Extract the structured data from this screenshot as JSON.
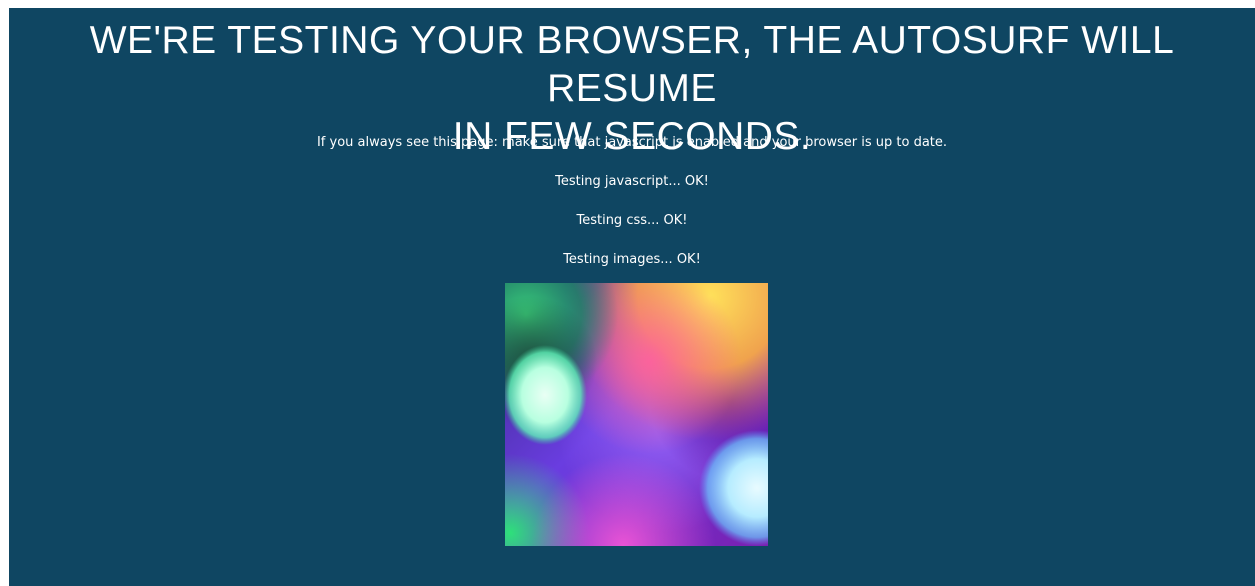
{
  "headline": {
    "line1": "WE'RE TESTING YOUR BROWSER, THE AUTOSURF WILL RESUME",
    "line2": "IN FEW SECONDS."
  },
  "message": "If you always see this page: make sure that javascript is enabled and your browser is up to date.",
  "tests": [
    "Testing javascript... OK!",
    "Testing css... OK!",
    "Testing images... OK!"
  ],
  "colors": {
    "background": "#0f4662",
    "text": "#ffffff"
  }
}
